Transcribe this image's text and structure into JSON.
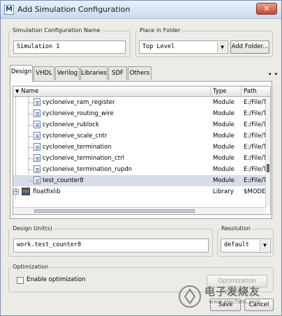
{
  "window": {
    "title": "Add Simulation Configuration",
    "app_icon": "M",
    "close_glyph": "✕"
  },
  "sim_config": {
    "label": "Simulation Configuration Name",
    "value": "Simulation 1"
  },
  "place_in_folder": {
    "label": "Place in Folder",
    "value": "Top Level",
    "add_folder_label": "Add Folder..."
  },
  "tabs": [
    "Design",
    "VHDL",
    "Verilog",
    "Libraries",
    "SDF",
    "Others"
  ],
  "tab_scroll": {
    "left": "◂",
    "right": "▸"
  },
  "tree": {
    "columns": {
      "name": "Name",
      "type": "Type",
      "path": "Path"
    },
    "rows": [
      {
        "name": "cycloneive_ram_register",
        "type": "Module",
        "path": "E:/File/TI"
      },
      {
        "name": "cycloneive_routing_wire",
        "type": "Module",
        "path": "E:/File/TI"
      },
      {
        "name": "cycloneive_rublock",
        "type": "Module",
        "path": "E:/File/TI"
      },
      {
        "name": "cycloneive_scale_cntr",
        "type": "Module",
        "path": "E:/File/TI"
      },
      {
        "name": "cycloneive_termination",
        "type": "Module",
        "path": "E:/File/TI"
      },
      {
        "name": "cycloneive_termination_ctrl",
        "type": "Module",
        "path": "E:/File/TI"
      },
      {
        "name": "cycloneive_termination_rupdn",
        "type": "Module",
        "path": "E:/File/TI"
      },
      {
        "name": "test_counter8",
        "type": "Module",
        "path": "E:/File/TI"
      },
      {
        "name": "floatfixlib",
        "type": "Library",
        "path": "$MODEL"
      }
    ]
  },
  "design_units": {
    "label": "Design Unit(s)",
    "value": "work.test_counter8"
  },
  "resolution": {
    "label": "Resolution",
    "value": "default"
  },
  "optimization": {
    "label": "Optimization",
    "enable_label": "Enable optimization",
    "options_label": "Optimization Options...",
    "enabled": false
  },
  "footer": {
    "ok_label": "Save",
    "cancel_label": "Cancel"
  },
  "watermark": {
    "text_cn": "电子发烧友",
    "text_url": "www.elecfans.com"
  }
}
